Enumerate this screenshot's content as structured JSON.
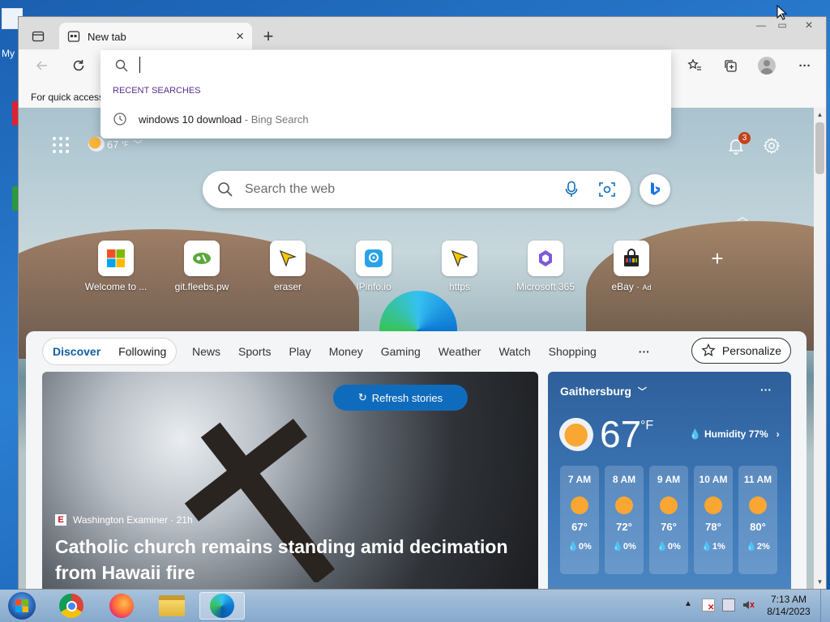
{
  "desktop": {
    "icon_label": "My"
  },
  "browser": {
    "tab": {
      "title": "New tab",
      "close": "×"
    },
    "new_tab": "+",
    "window_controls": {
      "minimize": "—",
      "maximize": "▭",
      "close": "✕"
    },
    "favorites_bar_text": "For quick access"
  },
  "address_dropdown": {
    "section_label": "RECENT SEARCHES",
    "items": [
      {
        "query": "windows 10 download",
        "source": " - Bing Search"
      }
    ]
  },
  "newtab": {
    "top": {
      "temperature": "67",
      "unit": "°F",
      "notifications": "3"
    },
    "search": {
      "placeholder": "Search the web"
    },
    "quick_links": [
      {
        "label": "Welcome to ...",
        "icon": "windows-icon"
      },
      {
        "label": "git.fleebs.pw",
        "icon": "git-icon"
      },
      {
        "label": "eraser",
        "icon": "pointer-icon"
      },
      {
        "label": "IPinfo.io",
        "icon": "ipinfo-icon"
      },
      {
        "label": "https",
        "icon": "pointer-icon"
      },
      {
        "label": "Microsoft 365",
        "icon": "m365-icon"
      },
      {
        "label": "eBay",
        "ad": "Ad",
        "icon": "shopping-bag-icon"
      }
    ],
    "add_shortcut": "+"
  },
  "feed": {
    "pill_tabs": [
      "Discover",
      "Following"
    ],
    "categories": [
      "News",
      "Sports",
      "Play",
      "Money",
      "Gaming",
      "Weather",
      "Watch",
      "Shopping"
    ],
    "more": "···",
    "personalize": "Personalize",
    "refresh": "Refresh stories",
    "hero": {
      "source": "Washington Examiner · 21h",
      "headline": "Catholic church remains standing amid decimation from Hawaii fire"
    }
  },
  "weather": {
    "city": "Gaithersburg",
    "temp": "67",
    "unit": "°F",
    "humidity": "Humidity 77%",
    "more": "···",
    "hours": [
      {
        "time": "7 AM",
        "temp": "67°",
        "rain": "0%"
      },
      {
        "time": "8 AM",
        "temp": "72°",
        "rain": "0%"
      },
      {
        "time": "9 AM",
        "temp": "76°",
        "rain": "0%"
      },
      {
        "time": "10 AM",
        "temp": "78°",
        "rain": "1%"
      },
      {
        "time": "11 AM",
        "temp": "80°",
        "rain": "2%"
      }
    ]
  },
  "taskbar": {
    "time": "7:13 AM",
    "date": "8/14/2023"
  },
  "colors": {
    "accent": "#0f6cbd",
    "selected_tab": "#115ea3",
    "badge": "#c4421a"
  }
}
